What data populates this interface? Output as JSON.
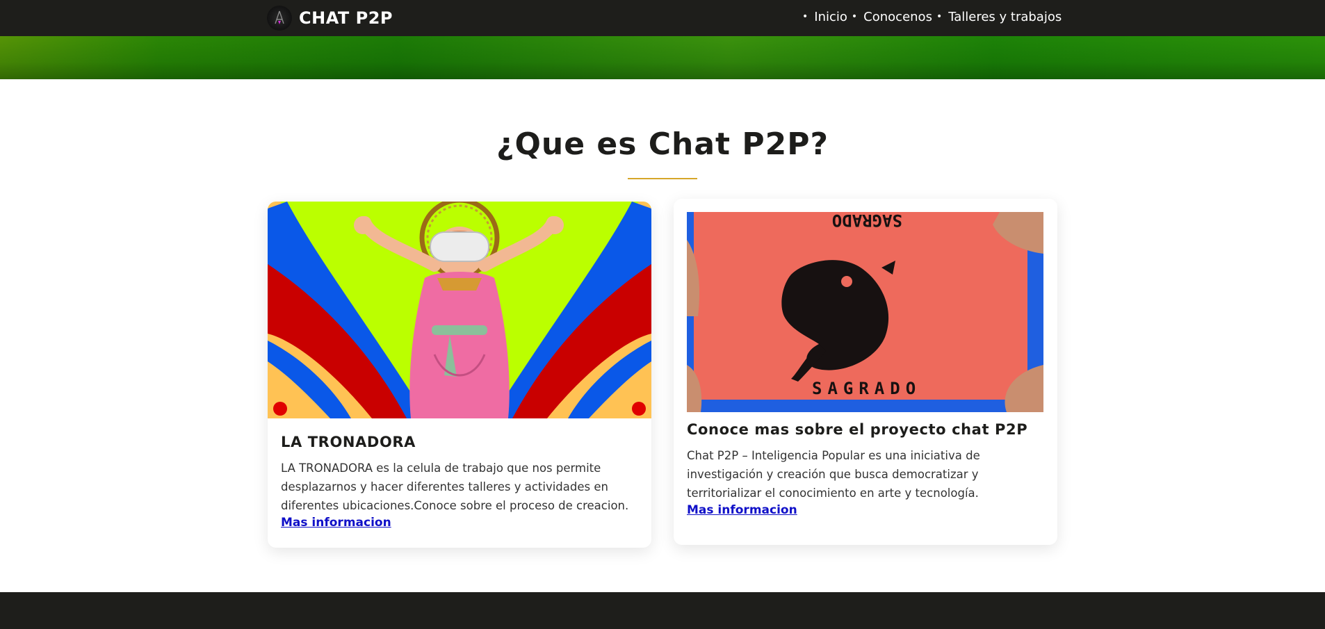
{
  "header": {
    "brand": "CHAT P2P",
    "nav": [
      {
        "label": "Inicio"
      },
      {
        "label": "Conocenos"
      },
      {
        "label": "Talleres y trabajos"
      }
    ]
  },
  "section": {
    "title": "¿Que es Chat P2P?"
  },
  "cards": [
    {
      "title": "LA TRONADORA",
      "text": "LA TRONADORA es la celula de trabajo que nos permite desplazarnos y hacer diferentes talleres y actividades en diferentes ubicaciones.Conoce sobre el proceso de creacion.",
      "link": "Mas informacion"
    },
    {
      "title": "Conoce mas sobre el proyecto chat P2P",
      "text": "Chat P2P – Inteligencia Popular es una iniciativa de investigación y creación que busca democratizar y territorializar el conocimiento en arte y tecnología.",
      "link": "Mas informacion",
      "image_letters": [
        "SAGRADO",
        "SAGRADO"
      ]
    }
  ],
  "colors": {
    "header_bg": "#1e1e1b",
    "accent_rule": "#d6a629",
    "link": "#1010c8",
    "banner": "#2e8e06"
  }
}
